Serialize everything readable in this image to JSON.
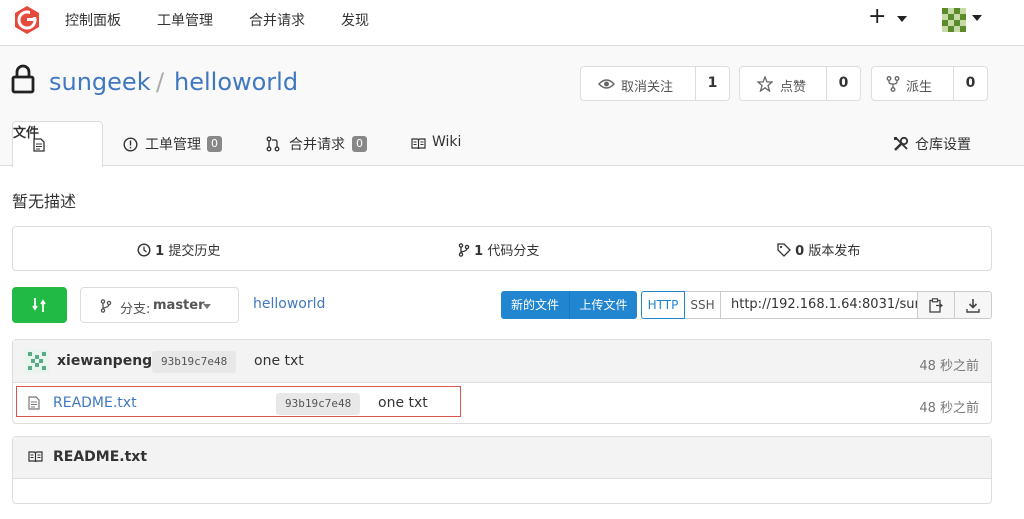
{
  "topnav": {
    "items": [
      "控制面板",
      "工单管理",
      "合并请求",
      "发现"
    ],
    "plus": "+"
  },
  "repo": {
    "owner": "sungeek",
    "separator": "/",
    "name": "helloworld",
    "watch": {
      "label": "取消关注",
      "count": "1"
    },
    "star": {
      "label": "点赞",
      "count": "0"
    },
    "fork": {
      "label": "派生",
      "count": "0"
    }
  },
  "tabs": {
    "files": "文件",
    "issues": {
      "label": "工单管理",
      "count": "0"
    },
    "pulls": {
      "label": "合并请求",
      "count": "0"
    },
    "wiki": "Wiki",
    "settings": "仓库设置"
  },
  "description": "暂无描述",
  "stats": {
    "commits": {
      "count": "1",
      "label": "提交历史"
    },
    "branches": {
      "count": "1",
      "label": "代码分支"
    },
    "releases": {
      "count": "0",
      "label": "版本发布"
    }
  },
  "toolbar": {
    "branch_prefix": "分支:",
    "branch": "master",
    "path": "helloworld",
    "new_file": "新的文件",
    "upload": "上传文件",
    "http": "HTTP",
    "ssh": "SSH",
    "clone_url": "http://192.168.1.64:8031/sur"
  },
  "latest_commit": {
    "author": "xiewanpeng",
    "sha": "93b19c7e48",
    "message": "one txt",
    "time": "48 秒之前"
  },
  "files": [
    {
      "name": "README.txt",
      "sha": "93b19c7e48",
      "message": "one txt",
      "time": "48 秒之前"
    }
  ],
  "readme": {
    "title": "README.txt"
  },
  "colors": {
    "accent": "#4078c0",
    "green": "#21ba45",
    "blue": "#2185d0",
    "logo": "#e64a3b"
  }
}
